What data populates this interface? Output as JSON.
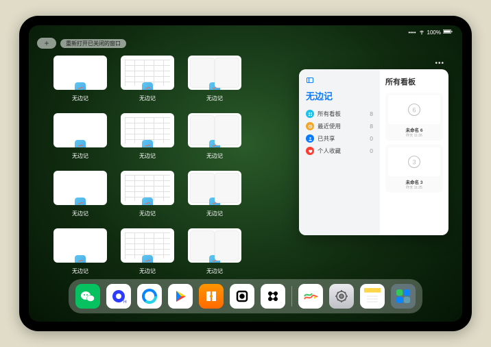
{
  "status": {
    "battery": "100%",
    "wifi": "wifi-icon",
    "signal": "signal-icon"
  },
  "topbar": {
    "add_label": "+",
    "chip_label": "重新打开已关闭的窗口"
  },
  "app_switcher": {
    "app_name": "无边记",
    "thumbnails": [
      {
        "label": "无边记",
        "type": "blank"
      },
      {
        "label": "无边记",
        "type": "grid"
      },
      {
        "label": "无边记",
        "type": "split"
      },
      {
        "label": "无边记",
        "type": "blank"
      },
      {
        "label": "无边记",
        "type": "grid"
      },
      {
        "label": "无边记",
        "type": "split"
      },
      {
        "label": "无边记",
        "type": "blank"
      },
      {
        "label": "无边记",
        "type": "grid"
      },
      {
        "label": "无边记",
        "type": "split"
      },
      {
        "label": "无边记",
        "type": "blank"
      },
      {
        "label": "无边记",
        "type": "grid"
      },
      {
        "label": "无边记",
        "type": "split"
      }
    ]
  },
  "panel": {
    "sidebar_title": "无边记",
    "items": [
      {
        "label": "所有看板",
        "count": "8",
        "color": "#18c3f0",
        "icon": "grid"
      },
      {
        "label": "最近使用",
        "count": "8",
        "color": "#f5a623",
        "icon": "clock"
      },
      {
        "label": "已共享",
        "count": "0",
        "color": "#0a7aff",
        "icon": "person"
      },
      {
        "label": "个人收藏",
        "count": "0",
        "color": "#ff3b30",
        "icon": "heart"
      }
    ],
    "right_title": "所有看板",
    "boards": [
      {
        "name": "未命名 6",
        "sub": "昨天 11:26",
        "digit": "6"
      },
      {
        "name": "未命名 3",
        "sub": "昨天 11:25",
        "digit": "3"
      }
    ]
  },
  "dock": {
    "apps": [
      {
        "name": "wechat",
        "bg": "#07c160"
      },
      {
        "name": "quark",
        "bg": "#ffffff"
      },
      {
        "name": "qqbrowser",
        "bg": "#ffffff"
      },
      {
        "name": "play",
        "bg": "#ffffff"
      },
      {
        "name": "books",
        "bg": "linear-gradient(#ff9500,#ff6a00)"
      },
      {
        "name": "other",
        "bg": "#ffffff"
      },
      {
        "name": "scan",
        "bg": "#ffffff"
      }
    ],
    "recent": [
      {
        "name": "freeform",
        "bg": "#ffffff"
      },
      {
        "name": "settings",
        "bg": "linear-gradient(#e9e9ee,#bfc0c6)"
      },
      {
        "name": "notes",
        "bg": "#ffffff"
      },
      {
        "name": "app-library",
        "bg": "rgba(120,140,160,0.55)"
      }
    ]
  }
}
